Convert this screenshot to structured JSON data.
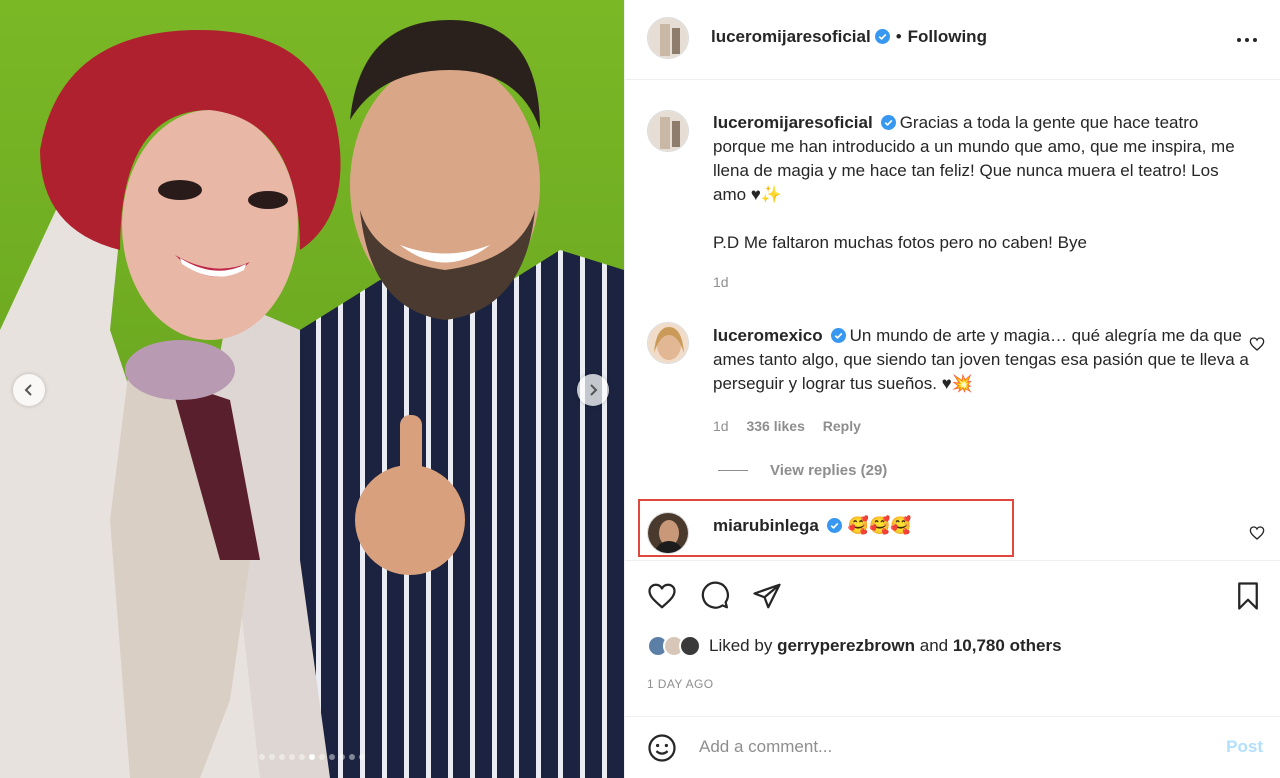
{
  "photo": {
    "carousel_dots": 11,
    "active_dot": 5
  },
  "header": {
    "username": "luceromijaresoficial",
    "separator": "•",
    "follow_status": "Following"
  },
  "caption": {
    "username": "luceromijaresoficial",
    "text_1": "Gracias a toda la gente que hace teatro porque me han introducido a un mundo que amo, que me inspira, me llena de magia y me hace tan feliz! Que nunca muera el teatro! Los amo ♥✨",
    "text_2": "P.D Me faltaron muchas fotos pero no caben! Bye",
    "time": "1d"
  },
  "comments": [
    {
      "username": "luceromexico",
      "text": "Un mundo de arte y magia… qué alegría me da que ames tanto algo, que siendo tan joven tengas esa pasión que te lleva a perseguir y lograr tus sueños. ♥💥",
      "time": "1d",
      "likes": "336 likes",
      "reply": "Reply",
      "view_replies": "View replies (29)"
    },
    {
      "username": "miarubinlega",
      "text": "🥰🥰🥰"
    }
  ],
  "likes": {
    "prefix": "Liked by",
    "user": "gerryperezbrown",
    "and": "and",
    "others": "10,780 others"
  },
  "time_ago": "1 DAY AGO",
  "add_comment": {
    "placeholder": "Add a comment...",
    "post_label": "Post"
  },
  "colors": {
    "verified": "#3897f0",
    "highlight": "#e0483d",
    "post_disabled": "#b2dffc",
    "secondary_text": "#8e8e8e"
  }
}
